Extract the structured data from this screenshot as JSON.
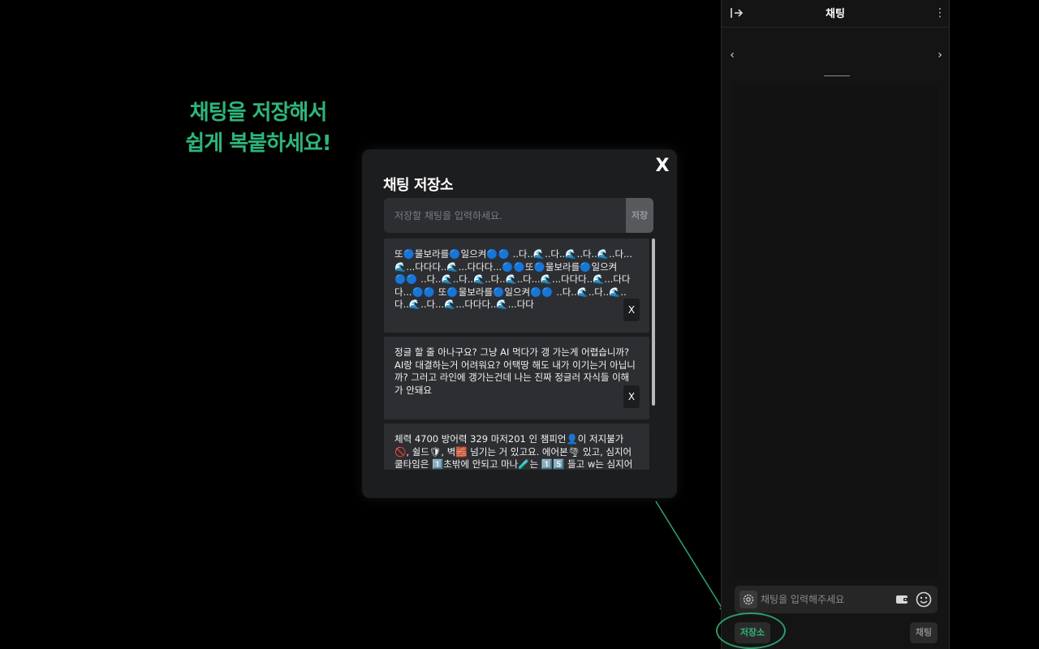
{
  "promo": {
    "line1": "채팅을 저장해서",
    "line2": "쉽게 복붙하세요!"
  },
  "modal": {
    "title": "채팅 저장소",
    "close_label": "X",
    "input_placeholder": "저장할 채팅을 입력하세요.",
    "save_label": "저장",
    "delete_label": "X",
    "scroll_position": 0,
    "items": [
      {
        "text": "또🔵물보라를🔵일으켜🔵🔵 ..다..🌊..다..🌊..다..🌊..다...🌊...다다다..🌊...다다다...🔵🔵또🔵물보라를🔵일으켜🔵🔵 ..다..🌊..다..🌊..다..🌊..다...🌊...다다다..🌊...다다다...🔵🔵 또🔵물보라를🔵일으켜🔵🔵 ..다..🌊..다..🌊..다..🌊..다...🌊...다다다..🌊...다다"
      },
      {
        "text": "정글 할 줄 아나구요? 그냥 AI 먹다가 갱 가는게 어렵습니까? AI랑 대결하는거 어려워요? 어택땅 해도 내가 이기는거 아닙니까? 그러고 라인에 갱가는건데 나는 진짜 정글러 자식들 이해가 안돼요"
      },
      {
        "text": "체력 4700 방어력 329 마저201 인 챔피언👤이 저지불가🚫, 쉴드🛡, 벽🧱 넘기는 거 있고요. 에어본🌪 있고, 심지어 쿨타임은 1️⃣초밖에 안되고 마나🧪는 1️⃣5️⃣ 들고 w는 심지어 변신하면 쿨이 초기화"
      }
    ]
  },
  "panel": {
    "title": "채팅",
    "input_placeholder": "채팅을 입력해주세요",
    "store_label": "저장소",
    "send_label": "채팅",
    "icons": {
      "collapse": "collapse-panel-icon",
      "more": "more-vertical-icon",
      "prev": "chevron-left-icon",
      "next": "chevron-right-icon",
      "settings": "gear-icon",
      "coin": "coin-wallet-icon",
      "emoji": "smiley-icon"
    }
  },
  "colors": {
    "accent_green": "#2fb57a",
    "ring_green": "#2f9b67",
    "modal_bg": "#1c1d1f",
    "card_bg": "#2d2e31"
  }
}
